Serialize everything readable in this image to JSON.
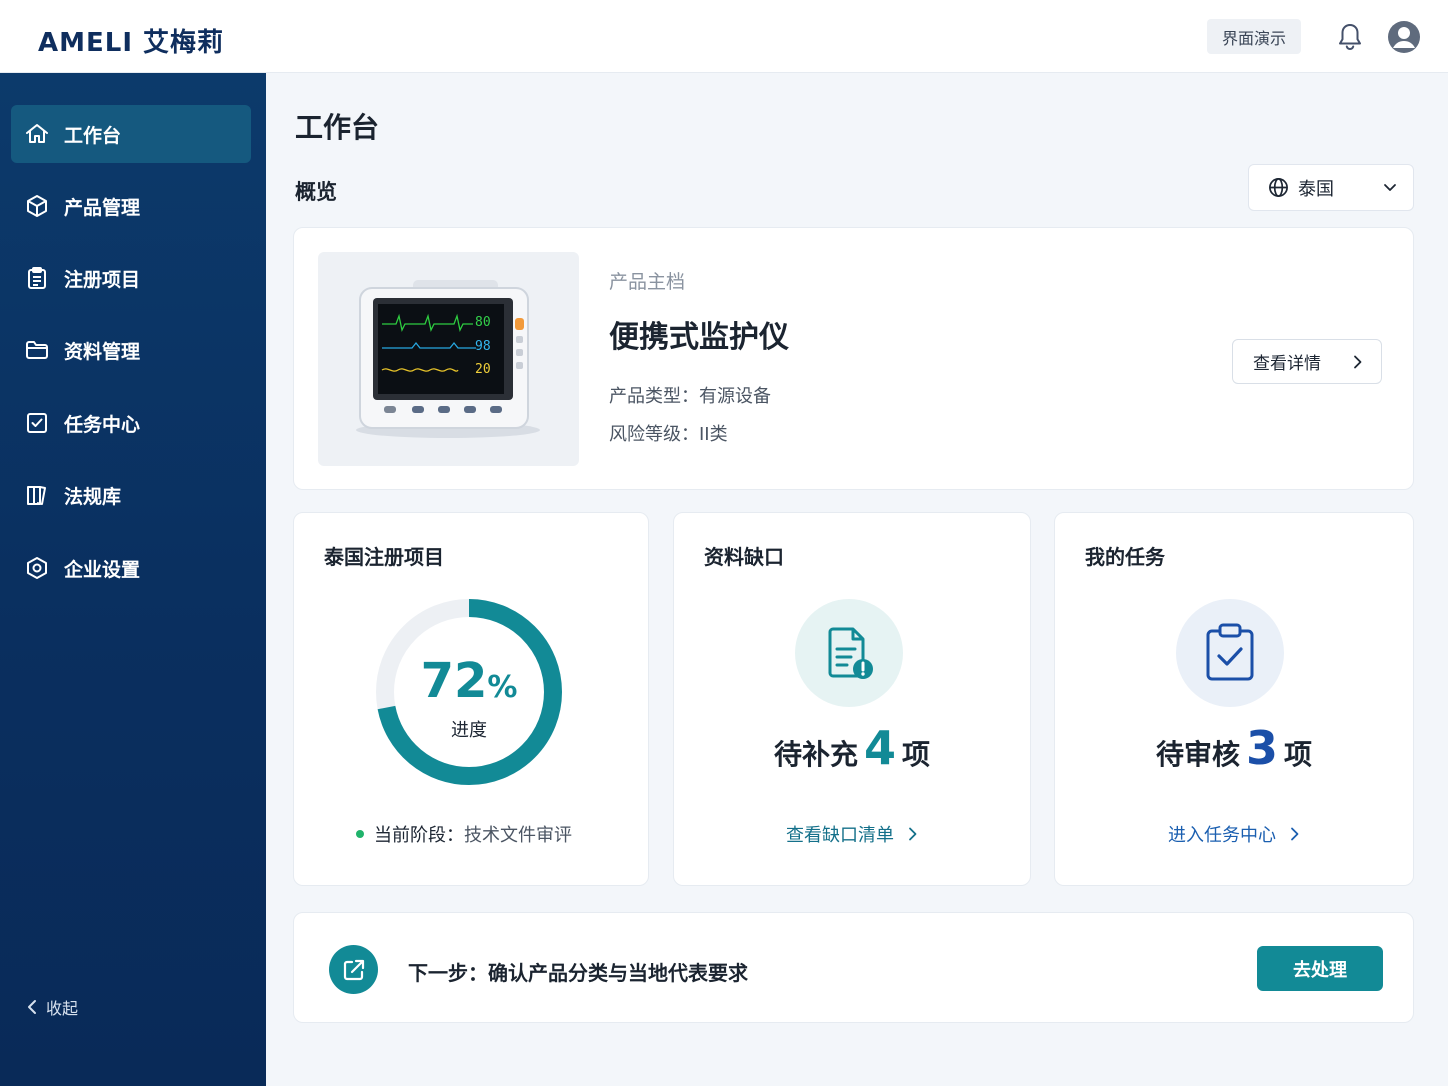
{
  "brand": {
    "logo_text": "AMELI 艾梅莉"
  },
  "header": {
    "demo_label": "界面演示",
    "bell_icon": "bell-icon",
    "avatar_icon": "user-avatar-icon"
  },
  "sidebar": {
    "items": [
      {
        "label": "工作台",
        "icon": "home-icon",
        "active": true
      },
      {
        "label": "产品管理",
        "icon": "box-icon",
        "active": false
      },
      {
        "label": "注册项目",
        "icon": "clipboard-icon",
        "active": false
      },
      {
        "label": "资料管理",
        "icon": "folder-icon",
        "active": false
      },
      {
        "label": "任务中心",
        "icon": "checkbox-icon",
        "active": false
      },
      {
        "label": "法规库",
        "icon": "book-icon",
        "active": false
      },
      {
        "label": "企业设置",
        "icon": "settings-icon",
        "active": false
      }
    ],
    "collapse_label": "收起"
  },
  "page": {
    "title": "工作台",
    "section": "概览",
    "region": "泰国"
  },
  "product": {
    "label": "产品主档",
    "name": "便携式监护仪",
    "type_line": "产品类型：有源设备",
    "risk_line": "风险等级：II类",
    "detail_button": "查看详情",
    "monitor_readings": [
      "80",
      "98",
      "20"
    ]
  },
  "project_card": {
    "title": "泰国注册项目",
    "progress_value": "72",
    "progress_unit": "%",
    "progress_label": "进度",
    "progress": 0.72,
    "stage_label": "当前阶段：",
    "stage_value": "技术文件审评"
  },
  "gap_card": {
    "title": "资料缺口",
    "prefix": "待补充",
    "count": "4",
    "suffix": "项",
    "link": "查看缺口清单"
  },
  "task_card": {
    "title": "我的任务",
    "prefix": "待审核",
    "count": "3",
    "suffix": "项",
    "link": "进入任务中心"
  },
  "next_step": {
    "text": "下一步：确认产品分类与当地代表要求",
    "button": "去处理"
  },
  "colors": {
    "accent": "#128a96",
    "sidebar": "#0a2f5f",
    "active_nav": "#15597f",
    "task_blue": "#1b4fa8"
  }
}
